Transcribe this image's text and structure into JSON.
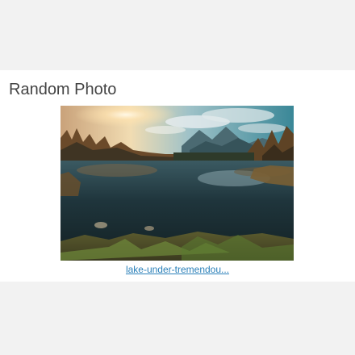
{
  "widget": {
    "title": "Random Photo",
    "photo": {
      "link_text": "lake-under-tremendou..."
    }
  },
  "colors": {
    "page_background": "#f2f2f2",
    "widget_background": "#ffffff",
    "title_text": "#444444",
    "link": "#2a80b9"
  }
}
